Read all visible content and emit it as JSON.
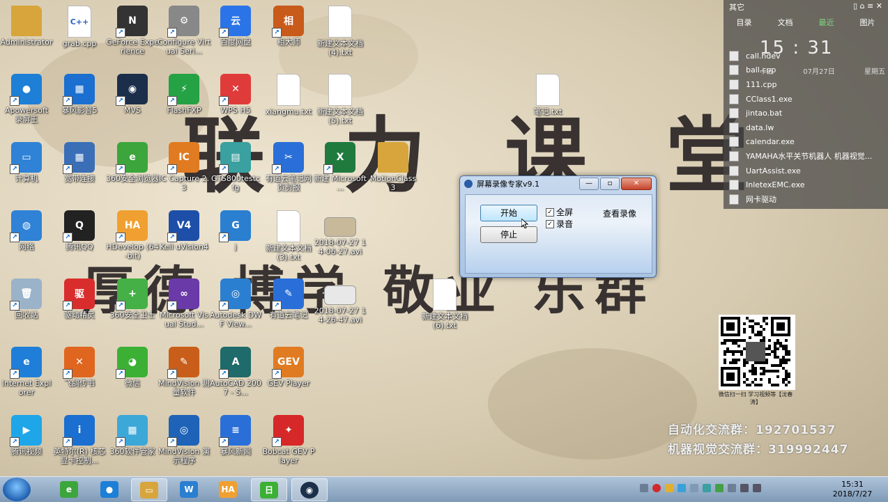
{
  "background": {
    "line1": "联 力 课 堂",
    "line2": "厚德 博学 敬业 乐群"
  },
  "icons": [
    {
      "label": "Administrator",
      "color": "#d7a53b",
      "type": "folder"
    },
    {
      "label": "grab.cpp",
      "color": "#ffffff",
      "type": "doc",
      "glyph": "C++"
    },
    {
      "label": "GeForce Experience",
      "color": "#333333",
      "type": "app",
      "glyph": "N"
    },
    {
      "label": "Configure Virtual Seri...",
      "color": "#888888",
      "type": "app",
      "glyph": "⚙"
    },
    {
      "label": "百度网盘",
      "color": "#2b74e8",
      "type": "app",
      "glyph": "云"
    },
    {
      "label": "相大师",
      "color": "#c85a1a",
      "type": "app",
      "glyph": "相"
    },
    {
      "label": "新建文本文档 (4).txt",
      "color": "#ffffff",
      "type": "doc"
    },
    {
      "label": "Apowersoft 录屏王",
      "color": "#1d7fd6",
      "type": "app",
      "glyph": "●"
    },
    {
      "label": "暴风影音5",
      "color": "#1a6fd0",
      "type": "app",
      "glyph": "▦"
    },
    {
      "label": "MVS",
      "color": "#1b2f4a",
      "type": "app",
      "glyph": "◉"
    },
    {
      "label": "FlashFXP",
      "color": "#25a244",
      "type": "app",
      "glyph": "⚡"
    },
    {
      "label": "WPS H5",
      "color": "#e03b3b",
      "type": "app",
      "glyph": "✕"
    },
    {
      "label": "xiangmu.txt",
      "color": "#ffffff",
      "type": "doc"
    },
    {
      "label": "新建文本文档 (5).txt",
      "color": "#ffffff",
      "type": "doc"
    },
    {
      "label": "笔记.txt",
      "color": "#ffffff",
      "type": "doc"
    },
    {
      "label": "计算机",
      "color": "#2f82d6",
      "type": "app",
      "glyph": "▭"
    },
    {
      "label": "宽带连接",
      "color": "#3a6fb8",
      "type": "app",
      "glyph": "▦"
    },
    {
      "label": "360安全浏览器",
      "color": "#3ca53c",
      "type": "app",
      "glyph": "e"
    },
    {
      "label": "IC Capture 2.3",
      "color": "#e07b22",
      "type": "app",
      "glyph": "IC"
    },
    {
      "label": "GTS800testc fg",
      "color": "#3aa0a0",
      "type": "app",
      "glyph": "▤"
    },
    {
      "label": "有道云笔记网页剪报",
      "color": "#2a6fd8",
      "type": "app",
      "glyph": "✂"
    },
    {
      "label": "新建 Microsoft ...",
      "color": "#1f7a3e",
      "type": "app",
      "glyph": "X"
    },
    {
      "label": "MotionClass 3",
      "color": "#d7a53b",
      "type": "folder"
    },
    {
      "label": "网络",
      "color": "#2f82d6",
      "type": "app",
      "glyph": "◍"
    },
    {
      "label": "腾讯QQ",
      "color": "#222222",
      "type": "app",
      "glyph": "Q"
    },
    {
      "label": "HDevelop (64-bit)",
      "color": "#f0a030",
      "type": "app",
      "glyph": "HA"
    },
    {
      "label": "Keil uVision4",
      "color": "#1e4fa8",
      "type": "app",
      "glyph": "V4"
    },
    {
      "label": "j",
      "color": "#2a7fd0",
      "type": "app",
      "glyph": "G"
    },
    {
      "label": "新建文本文档 (3).txt",
      "color": "#ffffff",
      "type": "doc"
    },
    {
      "label": "2018-07-27 14-06-27.avi",
      "color": "#c8b99a",
      "type": "video"
    },
    {
      "label": "回收站",
      "color": "#9bb3c9",
      "type": "app",
      "glyph": "🗑"
    },
    {
      "label": "驱动精灵",
      "color": "#d92d2d",
      "type": "app",
      "glyph": "驱"
    },
    {
      "label": "360安全卫士",
      "color": "#45b045",
      "type": "app",
      "glyph": "+"
    },
    {
      "label": "Microsoft Visual Stud...",
      "color": "#6a3aa8",
      "type": "app",
      "glyph": "∞"
    },
    {
      "label": "Autodesk DWF View...",
      "color": "#2b7fd0",
      "type": "app",
      "glyph": "◎"
    },
    {
      "label": "有道云笔记",
      "color": "#2a6fd8",
      "type": "app",
      "glyph": "✎"
    },
    {
      "label": "2018-07-27 14-26-47.avi",
      "color": "#e8e8e8",
      "type": "video"
    },
    {
      "label": "新建文本文档 (6).txt",
      "color": "#ffffff",
      "type": "doc"
    },
    {
      "label": "Internet Explorer",
      "color": "#1f7fd8",
      "type": "app",
      "glyph": "e"
    },
    {
      "label": "飞鸽传书",
      "color": "#e0651e",
      "type": "app",
      "glyph": "✕"
    },
    {
      "label": "微信",
      "color": "#3cb034",
      "type": "app",
      "glyph": "◕"
    },
    {
      "label": "MindVision 测量软件",
      "color": "#c95e1a",
      "type": "app",
      "glyph": "✎"
    },
    {
      "label": "AutoCAD 2007 - S...",
      "color": "#1f6a6a",
      "type": "app",
      "glyph": "A"
    },
    {
      "label": "GEV Player",
      "color": "#e07b22",
      "type": "app",
      "glyph": "GEV"
    },
    {
      "label": "腾讯视频",
      "color": "#1fa6e8",
      "type": "app",
      "glyph": "▶"
    },
    {
      "label": "英特尔(R) 核芯显卡控制...",
      "color": "#1a6fd0",
      "type": "app",
      "glyph": "i"
    },
    {
      "label": "360软件管家",
      "color": "#3ca8d8",
      "type": "app",
      "glyph": "▦"
    },
    {
      "label": "MindVision 演示程序",
      "color": "#1e63b8",
      "type": "app",
      "glyph": "◎"
    },
    {
      "label": "暴风新闻",
      "color": "#2a6fd8",
      "type": "app",
      "glyph": "≡"
    },
    {
      "label": "Bobcat GEV Player",
      "color": "#d62828",
      "type": "app",
      "glyph": "✦"
    }
  ],
  "right_panel": {
    "top_left": "其它",
    "tabs": [
      "目录",
      "文档",
      "最近",
      "图片"
    ],
    "active_tab": "最近",
    "time": "15 : 31",
    "date_left": "十五",
    "date_mid": "07月27日",
    "date_right": "星期五",
    "items": [
      "call.hdev",
      "ball.cpp",
      "111.cpp",
      "CClass1.exe",
      "jintao.bat",
      "data.lw",
      "calendar.exe",
      "YAMAHA水平关节机器人 机器视觉...",
      "UartAssist.exe",
      "InletexEMC.exe",
      "网卡驱动"
    ]
  },
  "dialog": {
    "title": "屏幕录像专家v9.1",
    "start": "开始",
    "stop": "停止",
    "fullscreen": "全屏",
    "record_audio": "录音",
    "view": "查看录像"
  },
  "qr_caption": "微信扫一扫 学习视频等【沈春涛】",
  "groups": {
    "automation": "自动化交流群：192701537",
    "vision": "机器视觉交流群：319992447"
  },
  "taskbar": {
    "time": "15:31",
    "date": "2018/7/27"
  }
}
